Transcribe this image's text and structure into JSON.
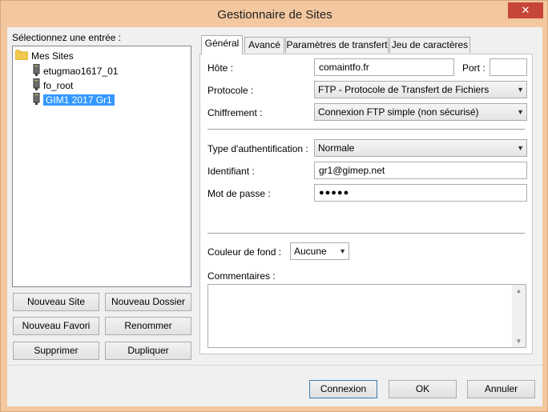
{
  "window": {
    "title": "Gestionnaire de Sites",
    "close_glyph": "✕"
  },
  "tree": {
    "label": "Sélectionnez une entrée :",
    "root": {
      "label": "Mes Sites",
      "icon": "folder-icon"
    },
    "items": [
      {
        "label": "etugmao1617_01",
        "icon": "server-icon"
      },
      {
        "label": "fo_root",
        "icon": "server-icon"
      },
      {
        "label": "GIM1 2017 Gr1",
        "icon": "server-icon",
        "selected": true
      }
    ]
  },
  "tree_buttons": {
    "new_site": "Nouveau Site",
    "new_folder": "Nouveau Dossier",
    "new_bookmark": "Nouveau Favori",
    "rename": "Renommer",
    "delete": "Supprimer",
    "duplicate": "Dupliquer"
  },
  "tabs": [
    {
      "label": "Général",
      "active": true
    },
    {
      "label": "Avancé"
    },
    {
      "label": "Paramètres de transfert"
    },
    {
      "label": "Jeu de caractères"
    }
  ],
  "general": {
    "host_label": "Hôte :",
    "host_value": "comaintfo.fr",
    "port_label": "Port :",
    "port_value": "",
    "protocol_label": "Protocole :",
    "protocol_value": "FTP - Protocole de Transfert de Fichiers",
    "encryption_label": "Chiffrement :",
    "encryption_value": "Connexion FTP simple (non sécurisé)",
    "auth_label": "Type d'authentification :",
    "auth_value": "Normale",
    "user_label": "Identifiant :",
    "user_value": "gr1@gimep.net",
    "password_label": "Mot de passe :",
    "password_value": "●●●●●",
    "bgcolor_label": "Couleur de fond :",
    "bgcolor_value": "Aucune",
    "comments_label": "Commentaires :"
  },
  "footer": {
    "connect": "Connexion",
    "ok": "OK",
    "cancel": "Annuler"
  }
}
